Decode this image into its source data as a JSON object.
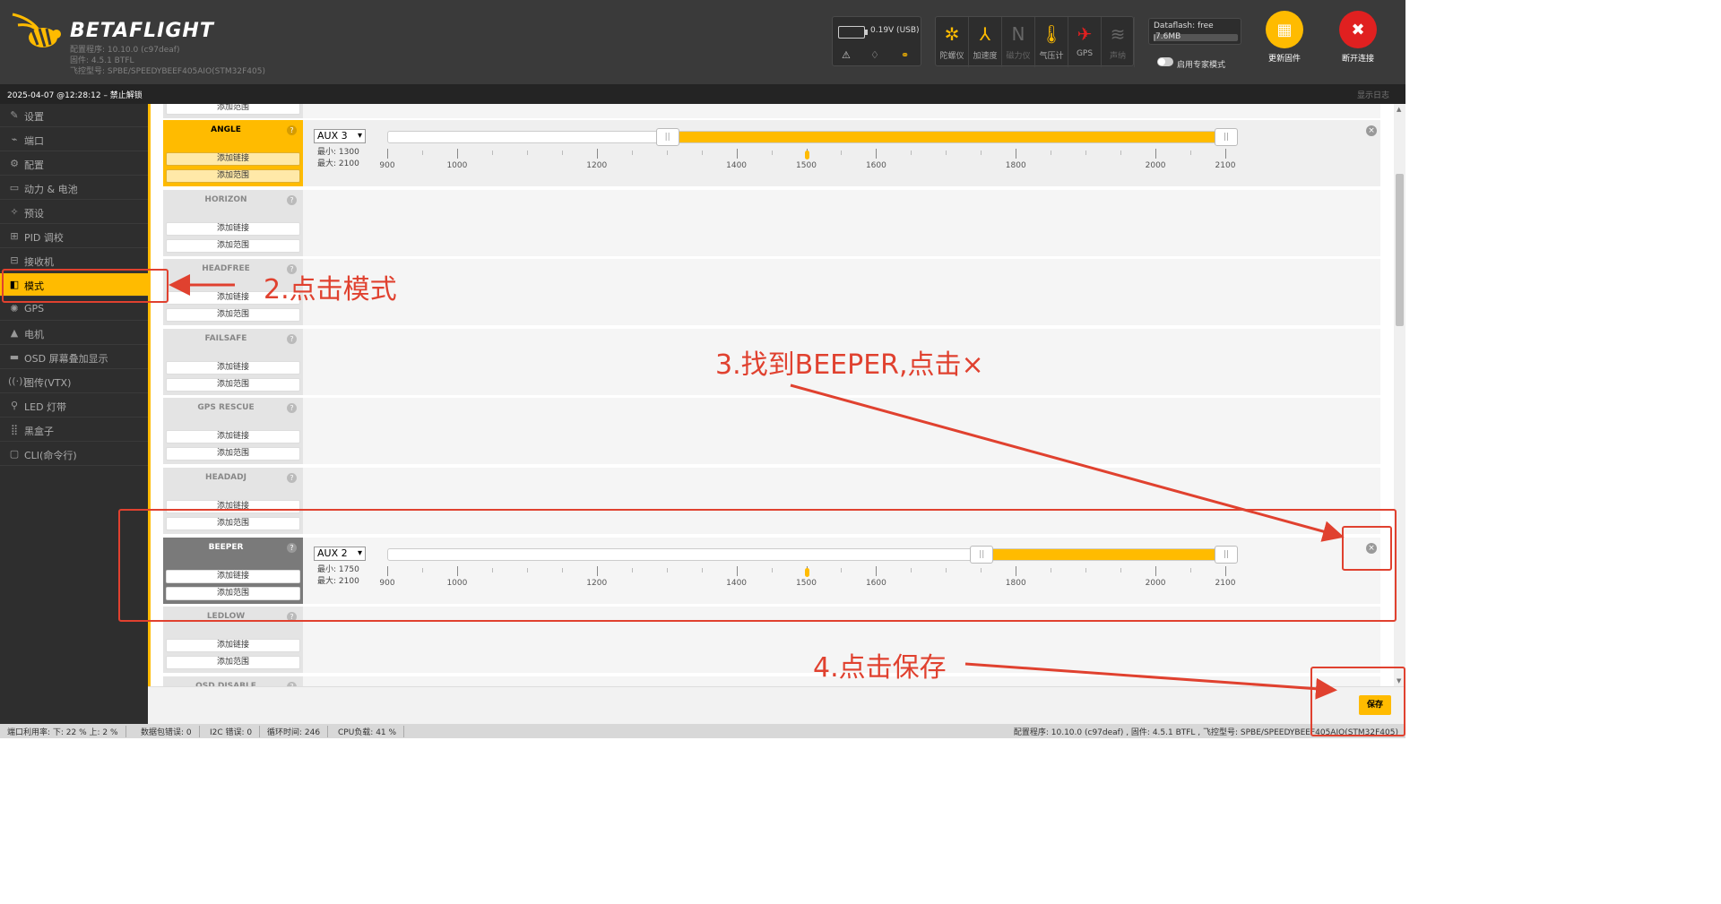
{
  "header": {
    "logo_text": "BETAFLIGHT",
    "config_version": "配置程序: 10.10.0 (c97deaf)",
    "firmware_version": "固件: 4.5.1 BTFL",
    "board": "飞控型号: SPBE/SPEEDYBEEF405AIO(STM32F405)",
    "battery": "0.19V (USB)",
    "dataflash_label": "Dataflash: free",
    "dataflash_size": "7.6MB",
    "dataflash_fill": 0.02,
    "expert_mode": "启用专家模式",
    "sensors": [
      {
        "label": "陀螺仪",
        "icon": "gyro-icon",
        "active": true,
        "glyph": "✲"
      },
      {
        "label": "加速度",
        "icon": "accelerometer-icon",
        "active": true,
        "glyph": "⅄"
      },
      {
        "label": "磁力仪",
        "icon": "magnetometer-icon",
        "active": false,
        "glyph": "N"
      },
      {
        "label": "气压计",
        "icon": "barometer-icon",
        "active": true,
        "glyph": "🌡"
      },
      {
        "label": "GPS",
        "icon": "gps-icon",
        "active": true,
        "glyph": "✈"
      },
      {
        "label": "声纳",
        "icon": "sonar-icon",
        "active": false,
        "glyph": "≋"
      }
    ],
    "flash_button": "更新固件",
    "disconnect_button": "断开连接"
  },
  "log": {
    "text": "2025-04-07 @12:28:12 – 禁止解锁",
    "show_log": "显示日志"
  },
  "sidebar": [
    {
      "label": "设置",
      "icon": "wrench-icon",
      "glyph": "✎"
    },
    {
      "label": "端口",
      "icon": "plug-icon",
      "glyph": "⌁"
    },
    {
      "label": "配置",
      "icon": "gear-icon",
      "glyph": "⚙"
    },
    {
      "label": "动力 & 电池",
      "icon": "battery-icon",
      "glyph": "▭"
    },
    {
      "label": "预设",
      "icon": "magic-icon",
      "glyph": "✧"
    },
    {
      "label": "PID 调校",
      "icon": "sitemap-icon",
      "glyph": "⊞"
    },
    {
      "label": "接收机",
      "icon": "receiver-icon",
      "glyph": "⊟"
    },
    {
      "label": "模式",
      "icon": "toggle-icon",
      "glyph": "◧",
      "active": true
    },
    {
      "label": "GPS",
      "icon": "satellite-icon",
      "glyph": "✺"
    },
    {
      "label": "电机",
      "icon": "motor-icon",
      "glyph": "▲"
    },
    {
      "label": "OSD 屏幕叠加显示",
      "icon": "osd-icon",
      "glyph": "▬"
    },
    {
      "label": "图传(VTX)",
      "icon": "vtx-icon",
      "glyph": "((·))"
    },
    {
      "label": "LED 灯带",
      "icon": "led-icon",
      "glyph": "⚲"
    },
    {
      "label": "黑盒子",
      "icon": "blackbox-icon",
      "glyph": "⣿"
    },
    {
      "label": "CLI(命令行)",
      "icon": "cli-icon",
      "glyph": "▢"
    }
  ],
  "modes": {
    "add_link": "添加链接",
    "add_range": "添加范围",
    "min_label": "最小:",
    "max_label": "最大:",
    "help": "?",
    "remove": "×",
    "tick_labels": [
      "900",
      "1000",
      "1200",
      "1400",
      "1500",
      "1600",
      "1800",
      "2000",
      "2100"
    ],
    "items": [
      {
        "name": "ANGLE",
        "state": "active",
        "aux": "AUX 3",
        "min": 1300,
        "max": 2100,
        "current": 1500
      },
      {
        "name": "HORIZON"
      },
      {
        "name": "HEADFREE"
      },
      {
        "name": "FAILSAFE"
      },
      {
        "name": "GPS RESCUE"
      },
      {
        "name": "HEADADJ"
      },
      {
        "name": "BEEPER",
        "state": "on",
        "aux": "AUX 2",
        "min": 1750,
        "max": 2100,
        "current": 1500
      },
      {
        "name": "LEDLOW"
      },
      {
        "name": "OSD DISABLE"
      }
    ]
  },
  "save_button": "保存",
  "status_bar": {
    "port_usage": "端口利用率:  下: 22 %  上: 2 %",
    "packet_errors": "数据包错误: 0",
    "i2c_errors": "I2C 错误: 0",
    "cycle_time": "循环时间: 246",
    "cpu_load": "CPU负载: 41 %",
    "right": "配置程序: 10.10.0 (c97deaf) , 固件: 4.5.1 BTFL , 飞控型号: SPBE/SPEEDYBEEF405AIO(STM32F405)"
  },
  "annotations": {
    "step2": "2.点击模式",
    "step3": "3.找到BEEPER,点击×",
    "step4": "4.点击保存",
    "color": "#e0412f"
  }
}
